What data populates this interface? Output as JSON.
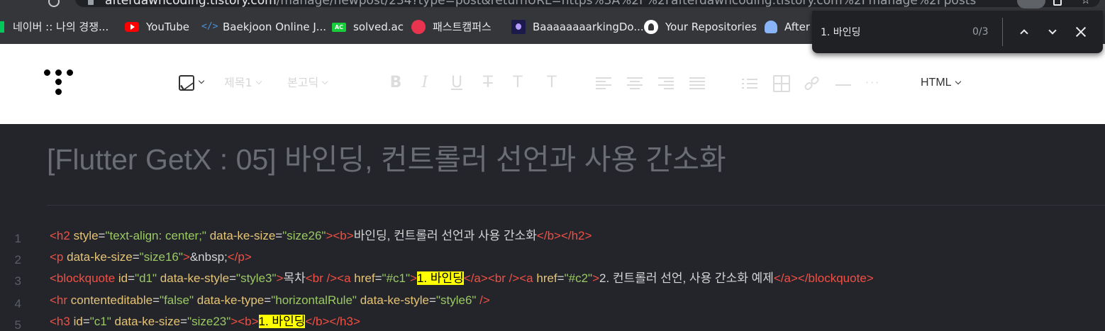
{
  "browser": {
    "url_host": "afterdawncoding.tistory.com",
    "url_path": "/manage/newpost/234?type=post&returnURL=https%3A%2F%2Fafterdawncoding.tistory.com%2Fmanage%2Fposts",
    "bookmarks": [
      {
        "label": "네이버 :: 나의 경쟁...",
        "icon": "naver-icon"
      },
      {
        "label": "YouTube",
        "icon": "youtube-icon"
      },
      {
        "label": "Baekjoon Online J...",
        "icon": "code-brackets-icon"
      },
      {
        "label": "solved.ac",
        "icon": "solved-ac-icon"
      },
      {
        "label": "패스트캠퍼스",
        "icon": "fastcampus-icon"
      },
      {
        "label": "BaaaaaaaarkingDo...",
        "icon": "baaaarking-icon"
      },
      {
        "label": "Your Repositories",
        "icon": "github-icon"
      },
      {
        "label": "After",
        "icon": "profile-icon"
      }
    ]
  },
  "find_bar": {
    "query": "1. 바인딩",
    "count": "0/3"
  },
  "toolbar": {
    "heading_select": "제목1",
    "font_select": "본고딕",
    "color_glyph": "T",
    "bg_glyph": "T",
    "more_glyph": "···",
    "mode": "HTML",
    "accent": "#333333"
  },
  "post": {
    "title": "[Flutter GetX : 05] 바인딩, 컨트롤러 선언과 사용 간소화"
  },
  "code": {
    "line_numbers": [
      "1",
      "2",
      "3",
      "4",
      "5"
    ],
    "colors": {
      "tag": "#f14f43",
      "attr": "#e6c476",
      "value": "#9bc963",
      "text": "#d4d4d4",
      "highlight": "#ffff00"
    },
    "lines": [
      [
        {
          "t": "tag",
          "s": "<h2"
        },
        {
          "t": "txt",
          "s": " "
        },
        {
          "t": "attr",
          "s": "style"
        },
        {
          "t": "txt",
          "s": "="
        },
        {
          "t": "val",
          "s": "\"text-align: center;\""
        },
        {
          "t": "txt",
          "s": " "
        },
        {
          "t": "attr",
          "s": "data-ke-size"
        },
        {
          "t": "txt",
          "s": "="
        },
        {
          "t": "val",
          "s": "\"size26\""
        },
        {
          "t": "tag",
          "s": "><b>"
        },
        {
          "t": "txt",
          "s": "바인딩, 컨트롤러 선언과 사용 간소화"
        },
        {
          "t": "tag",
          "s": "</b></h2>"
        }
      ],
      [
        {
          "t": "tag",
          "s": "<p"
        },
        {
          "t": "txt",
          "s": " "
        },
        {
          "t": "attr",
          "s": "data-ke-size"
        },
        {
          "t": "txt",
          "s": "="
        },
        {
          "t": "val",
          "s": "\"size16\""
        },
        {
          "t": "tag",
          "s": ">"
        },
        {
          "t": "txt",
          "s": "&nbsp;"
        },
        {
          "t": "tag",
          "s": "</p>"
        }
      ],
      [
        {
          "t": "tag",
          "s": "<blockquote"
        },
        {
          "t": "txt",
          "s": " "
        },
        {
          "t": "attr",
          "s": "id"
        },
        {
          "t": "txt",
          "s": "="
        },
        {
          "t": "val",
          "s": "\"d1\""
        },
        {
          "t": "txt",
          "s": " "
        },
        {
          "t": "attr",
          "s": "data-ke-style"
        },
        {
          "t": "txt",
          "s": "="
        },
        {
          "t": "val",
          "s": "\"style3\""
        },
        {
          "t": "tag",
          "s": ">"
        },
        {
          "t": "txt",
          "s": "목차"
        },
        {
          "t": "tag",
          "s": "<br /><a"
        },
        {
          "t": "txt",
          "s": " "
        },
        {
          "t": "attr",
          "s": "href"
        },
        {
          "t": "txt",
          "s": "="
        },
        {
          "t": "val",
          "s": "\"#c1\""
        },
        {
          "t": "tag",
          "s": ">"
        },
        {
          "t": "hl",
          "s": "1. 바인딩"
        },
        {
          "t": "tag",
          "s": "</a><br /><a"
        },
        {
          "t": "txt",
          "s": " "
        },
        {
          "t": "attr",
          "s": "href"
        },
        {
          "t": "txt",
          "s": "="
        },
        {
          "t": "val",
          "s": "\"#c2\""
        },
        {
          "t": "tag",
          "s": ">"
        },
        {
          "t": "txt",
          "s": "2. 컨트롤러 선언, 사용 간소화 예제"
        },
        {
          "t": "tag",
          "s": "</a></blockquote>"
        }
      ],
      [
        {
          "t": "tag",
          "s": "<hr"
        },
        {
          "t": "txt",
          "s": " "
        },
        {
          "t": "attr",
          "s": "contenteditable"
        },
        {
          "t": "txt",
          "s": "="
        },
        {
          "t": "val",
          "s": "\"false\""
        },
        {
          "t": "txt",
          "s": " "
        },
        {
          "t": "attr",
          "s": "data-ke-type"
        },
        {
          "t": "txt",
          "s": "="
        },
        {
          "t": "val",
          "s": "\"horizontalRule\""
        },
        {
          "t": "txt",
          "s": " "
        },
        {
          "t": "attr",
          "s": "data-ke-style"
        },
        {
          "t": "txt",
          "s": "="
        },
        {
          "t": "val",
          "s": "\"style6\""
        },
        {
          "t": "txt",
          "s": " "
        },
        {
          "t": "tag",
          "s": "/>"
        }
      ],
      [
        {
          "t": "tag",
          "s": "<h3"
        },
        {
          "t": "txt",
          "s": " "
        },
        {
          "t": "attr",
          "s": "id"
        },
        {
          "t": "txt",
          "s": "="
        },
        {
          "t": "val",
          "s": "\"c1\""
        },
        {
          "t": "txt",
          "s": " "
        },
        {
          "t": "attr",
          "s": "data-ke-size"
        },
        {
          "t": "txt",
          "s": "="
        },
        {
          "t": "val",
          "s": "\"size23\""
        },
        {
          "t": "tag",
          "s": "><b>"
        },
        {
          "t": "hl",
          "s": "1. 바인딩"
        },
        {
          "t": "tag",
          "s": "</b></h3>"
        }
      ]
    ]
  }
}
